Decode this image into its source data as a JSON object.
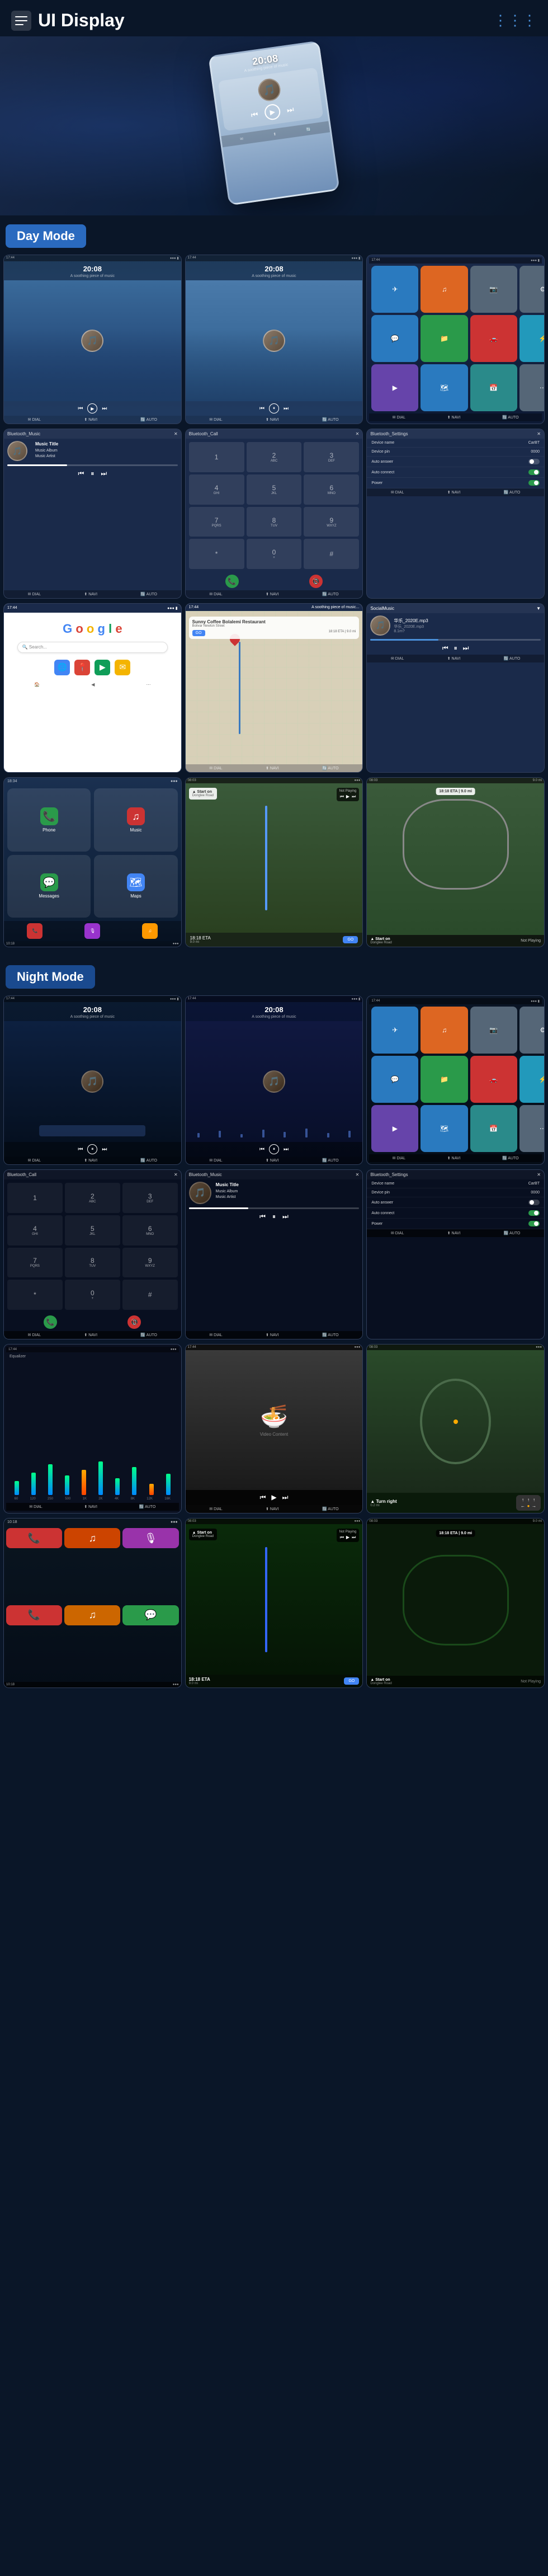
{
  "header": {
    "title": "UI Display",
    "nav_icon": "≡"
  },
  "day_mode": {
    "label": "Day Mode",
    "screens": [
      {
        "type": "music_player",
        "time": "20:08",
        "subtitle": "A soothing piece of music"
      },
      {
        "type": "music_player2",
        "time": "20:08",
        "subtitle": "A soothing piece of music"
      },
      {
        "type": "app_grid"
      },
      {
        "type": "bluetooth_music",
        "title": "Bluetooth_Music"
      },
      {
        "type": "bluetooth_call",
        "title": "Bluetooth_Call"
      },
      {
        "type": "bluetooth_settings",
        "title": "Bluetooth_Settings"
      },
      {
        "type": "google"
      },
      {
        "type": "map"
      },
      {
        "type": "social_music",
        "title": "SocialMusic"
      },
      {
        "type": "carplay_home"
      },
      {
        "type": "nav_waze"
      },
      {
        "type": "nav_map_right"
      }
    ]
  },
  "night_mode": {
    "label": "Night Mode",
    "screens": [
      {
        "type": "music_night_1",
        "time": "20:08"
      },
      {
        "type": "music_night_2",
        "time": "20:08"
      },
      {
        "type": "app_grid_night"
      },
      {
        "type": "bt_call_night",
        "title": "Bluetooth_Call"
      },
      {
        "type": "bt_music_night",
        "title": "Bluetooth_Music"
      },
      {
        "type": "bt_settings_night",
        "title": "Bluetooth_Settings"
      },
      {
        "type": "equalizer"
      },
      {
        "type": "food_bowl"
      },
      {
        "type": "nav_night"
      },
      {
        "type": "carplay_night"
      },
      {
        "type": "waze_night"
      },
      {
        "type": "nav_panel_night"
      }
    ]
  },
  "music": {
    "title": "Music Title",
    "album": "Music Album",
    "artist": "Music Artist"
  },
  "bt_settings": {
    "device_name_label": "Device name",
    "device_name_value": "CarBT",
    "device_pin_label": "Device pin",
    "device_pin_value": "0000",
    "auto_answer_label": "Auto answer",
    "auto_connect_label": "Auto connect",
    "power_label": "Power"
  },
  "coffee": {
    "name": "Sunny Coffee",
    "location_name": "Sunny Coffee Bolalemi Restaurant",
    "address": "Bolivar Newton Street",
    "eta_label": "18:18 ETA",
    "distance": "9.0 mi",
    "go_label": "GO"
  },
  "navigation": {
    "eta": "18:18 ETA",
    "distance": "9.0 mi",
    "start_on": "Start on",
    "street": "Donglee Road",
    "not_playing": "Not Playing"
  },
  "keypad": {
    "keys": [
      "1",
      "2",
      "3",
      "4",
      "5",
      "6",
      "7",
      "8",
      "9",
      "*",
      "0",
      "#"
    ]
  },
  "status_bar": {
    "time_left": "17:44",
    "time_right": "17:44",
    "signal": "●●●",
    "battery": "▮"
  }
}
